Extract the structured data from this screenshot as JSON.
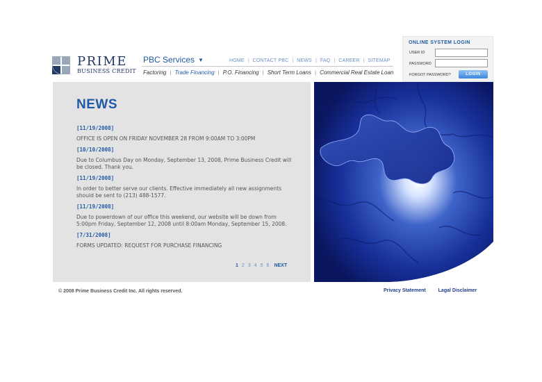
{
  "brand": {
    "name": "PRIME",
    "subtitle": "BUSINESS CREDIT",
    "colors": {
      "primary": "#1f5aa6",
      "navy": "#1f3864",
      "panel": "#e3e3e3"
    }
  },
  "pbc_services": {
    "label": "PBC Services",
    "icon": "chevron-down-icon"
  },
  "top_nav": [
    "HOME",
    "CONTACT PBC",
    "NEWS",
    "FAQ",
    "CAREER",
    "SITEMAP"
  ],
  "services_nav": [
    {
      "label": "Factoring",
      "active": false
    },
    {
      "label": "Trade Financing",
      "active": true
    },
    {
      "label": "P.O. Financing",
      "active": false
    },
    {
      "label": "Short Term Loans",
      "active": false
    },
    {
      "label": "Commercial Real Estate Loan",
      "active": false
    }
  ],
  "login": {
    "title": "ONLINE SYSTEM LOGIN",
    "user_label": "USER ID",
    "user_value": "",
    "password_label": "PASSWORD",
    "password_value": "",
    "forgot_label": "FORGOT PASSWORD?",
    "button_label": "LOGIN"
  },
  "news": {
    "title": "NEWS",
    "items": [
      {
        "date": "[11/19/2008]",
        "text": "OFFICE IS OPEN ON FRIDAY NOVEMBER 28 FROM 9:00AM TO 3:00PM"
      },
      {
        "date": "[10/10/2008]",
        "text": "Due to Columbus Day on Monday, September 13, 2008, Prime Business Credit will be closed. Thank you."
      },
      {
        "date": "[11/19/2008]",
        "text": "In order to better serve our clients. Effective immediately all new assignments should be sent to (213) 488-1577."
      },
      {
        "date": "[11/19/2008]",
        "text": "Due to powerdown of our office this weekend, our website will be down from 5:00pm Friday, September 12, 2008 until 8:00am Monday, September 15, 2008."
      },
      {
        "date": "[7/31/2008]",
        "text": "FORMS UPDATED: REQUEST FOR PURCHASE FINANCING"
      }
    ],
    "pagination": {
      "pages": [
        "1",
        "2",
        "3",
        "4",
        "5",
        "6"
      ],
      "current": "1",
      "next_label": "NEXT"
    }
  },
  "footer": {
    "copyright": "© 2008 Prime Business Credit Inc. All rights reserved.",
    "links": [
      "Privacy Statement",
      "Lagal Disclaimer"
    ]
  }
}
